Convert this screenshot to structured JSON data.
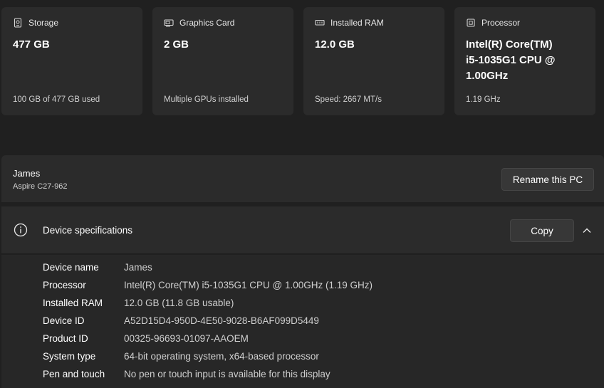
{
  "cards": [
    {
      "icon": "storage-icon",
      "label": "Storage",
      "value": "477 GB",
      "sub": "100 GB of 477 GB used"
    },
    {
      "icon": "graphics-card-icon",
      "label": "Graphics Card",
      "value": "2 GB",
      "sub": "Multiple GPUs installed"
    },
    {
      "icon": "ram-icon",
      "label": "Installed RAM",
      "value": "12.0 GB",
      "sub": "Speed: 2667 MT/s"
    },
    {
      "icon": "processor-icon",
      "label": "Processor",
      "value_lines": [
        "Intel(R) Core(TM)",
        "i5-1035G1 CPU @",
        "1.00GHz"
      ],
      "sub": "1.19 GHz"
    }
  ],
  "pc": {
    "name": "James",
    "model": "Aspire C27-962",
    "rename_label": "Rename this PC"
  },
  "specs": {
    "title": "Device specifications",
    "copy_label": "Copy",
    "rows": [
      {
        "key": "Device name",
        "value": "James"
      },
      {
        "key": "Processor",
        "value": "Intel(R) Core(TM) i5-1035G1 CPU @ 1.00GHz (1.19 GHz)"
      },
      {
        "key": "Installed RAM",
        "value": "12.0 GB (11.8 GB usable)"
      },
      {
        "key": "Device ID",
        "value": "A52D15D4-950D-4E50-9028-B6AF099D5449"
      },
      {
        "key": "Product ID",
        "value": "00325-96693-01097-AAOEM"
      },
      {
        "key": "System type",
        "value": "64-bit operating system, x64-based processor"
      },
      {
        "key": "Pen and touch",
        "value": "No pen or touch input is available for this display"
      }
    ]
  },
  "colors": {
    "background": "#202020",
    "card": "#2b2b2b",
    "button": "#373737"
  }
}
